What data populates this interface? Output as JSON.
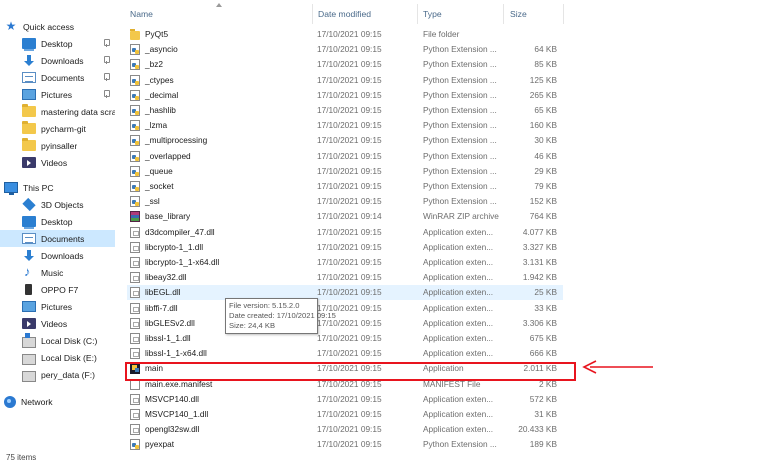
{
  "sidebar": {
    "items": [
      {
        "label": "Quick access",
        "icon": "star-icon",
        "pinned": false
      },
      {
        "label": "Desktop",
        "icon": "desktop-icon",
        "pinned": true
      },
      {
        "label": "Downloads",
        "icon": "downloads-icon",
        "pinned": true
      },
      {
        "label": "Documents",
        "icon": "documents-icon",
        "pinned": true
      },
      {
        "label": "Pictures",
        "icon": "pictures-icon",
        "pinned": true
      },
      {
        "label": "mastering data scra",
        "icon": "folder-icon",
        "pinned": false
      },
      {
        "label": "pycharm-git",
        "icon": "folder-icon",
        "pinned": false
      },
      {
        "label": "pyinsaller",
        "icon": "folder-icon",
        "pinned": false
      },
      {
        "label": "Videos",
        "icon": "videos-icon",
        "pinned": false
      },
      {
        "label": "This PC",
        "icon": "this-pc-icon",
        "pinned": false
      },
      {
        "label": "3D Objects",
        "icon": "3d-objects-icon",
        "pinned": false
      },
      {
        "label": "Desktop",
        "icon": "desktop-icon",
        "pinned": false
      },
      {
        "label": "Documents",
        "icon": "documents-icon",
        "pinned": false,
        "selected": true
      },
      {
        "label": "Downloads",
        "icon": "downloads-icon",
        "pinned": false
      },
      {
        "label": "Music",
        "icon": "music-icon",
        "pinned": false
      },
      {
        "label": "OPPO F7",
        "icon": "phone-icon",
        "pinned": false
      },
      {
        "label": "Pictures",
        "icon": "pictures-icon",
        "pinned": false
      },
      {
        "label": "Videos",
        "icon": "videos-icon",
        "pinned": false
      },
      {
        "label": "Local Disk (C:)",
        "icon": "drive-icon",
        "pinned": false
      },
      {
        "label": "Local Disk (E:)",
        "icon": "drive-icon",
        "pinned": false
      },
      {
        "label": "pery_data (F:)",
        "icon": "drive-icon",
        "pinned": false
      },
      {
        "label": "Network",
        "icon": "network-icon",
        "pinned": false
      }
    ]
  },
  "status": {
    "item_count": "75 items"
  },
  "columns": {
    "name": "Name",
    "date": "Date modified",
    "type": "Type",
    "size": "Size"
  },
  "files": [
    {
      "name": "PyQt5",
      "date": "17/10/2021 09:15",
      "type": "File folder",
      "size": "",
      "icon": "folder"
    },
    {
      "name": "_asyncio",
      "date": "17/10/2021 09:15",
      "type": "Python Extension ...",
      "size": "64 KB",
      "icon": "pyd"
    },
    {
      "name": "_bz2",
      "date": "17/10/2021 09:15",
      "type": "Python Extension ...",
      "size": "85 KB",
      "icon": "pyd"
    },
    {
      "name": "_ctypes",
      "date": "17/10/2021 09:15",
      "type": "Python Extension ...",
      "size": "125 KB",
      "icon": "pyd"
    },
    {
      "name": "_decimal",
      "date": "17/10/2021 09:15",
      "type": "Python Extension ...",
      "size": "265 KB",
      "icon": "pyd"
    },
    {
      "name": "_hashlib",
      "date": "17/10/2021 09:15",
      "type": "Python Extension ...",
      "size": "65 KB",
      "icon": "pyd"
    },
    {
      "name": "_lzma",
      "date": "17/10/2021 09:15",
      "type": "Python Extension ...",
      "size": "160 KB",
      "icon": "pyd"
    },
    {
      "name": "_multiprocessing",
      "date": "17/10/2021 09:15",
      "type": "Python Extension ...",
      "size": "30 KB",
      "icon": "pyd"
    },
    {
      "name": "_overlapped",
      "date": "17/10/2021 09:15",
      "type": "Python Extension ...",
      "size": "46 KB",
      "icon": "pyd"
    },
    {
      "name": "_queue",
      "date": "17/10/2021 09:15",
      "type": "Python Extension ...",
      "size": "29 KB",
      "icon": "pyd"
    },
    {
      "name": "_socket",
      "date": "17/10/2021 09:15",
      "type": "Python Extension ...",
      "size": "79 KB",
      "icon": "pyd"
    },
    {
      "name": "_ssl",
      "date": "17/10/2021 09:15",
      "type": "Python Extension ...",
      "size": "152 KB",
      "icon": "pyd"
    },
    {
      "name": "base_library",
      "date": "17/10/2021 09:14",
      "type": "WinRAR ZIP archive",
      "size": "764 KB",
      "icon": "rar"
    },
    {
      "name": "d3dcompiler_47.dll",
      "date": "17/10/2021 09:15",
      "type": "Application exten...",
      "size": "4.077 KB",
      "icon": "dll"
    },
    {
      "name": "libcrypto-1_1.dll",
      "date": "17/10/2021 09:15",
      "type": "Application exten...",
      "size": "3.327 KB",
      "icon": "dll"
    },
    {
      "name": "libcrypto-1_1-x64.dll",
      "date": "17/10/2021 09:15",
      "type": "Application exten...",
      "size": "3.131 KB",
      "icon": "dll"
    },
    {
      "name": "libeay32.dll",
      "date": "17/10/2021 09:15",
      "type": "Application exten...",
      "size": "1.942 KB",
      "icon": "dll"
    },
    {
      "name": "libEGL.dll",
      "date": "17/10/2021 09:15",
      "type": "Application exten...",
      "size": "25 KB",
      "icon": "dll",
      "hover": true
    },
    {
      "name": "libffi-7.dll",
      "date": "17/10/2021 09:15",
      "type": "Application exten...",
      "size": "33 KB",
      "icon": "dll"
    },
    {
      "name": "libGLESv2.dll",
      "date": "17/10/2021 09:15",
      "type": "Application exten...",
      "size": "3.306 KB",
      "icon": "dll"
    },
    {
      "name": "libssl-1_1.dll",
      "date": "17/10/2021 09:15",
      "type": "Application exten...",
      "size": "675 KB",
      "icon": "dll"
    },
    {
      "name": "libssl-1_1-x64.dll",
      "date": "17/10/2021 09:15",
      "type": "Application exten...",
      "size": "666 KB",
      "icon": "dll"
    },
    {
      "name": "main",
      "date": "17/10/2021 09:15",
      "type": "Application",
      "size": "2.011 KB",
      "icon": "exe",
      "highlighted": true
    },
    {
      "name": "main.exe.manifest",
      "date": "17/10/2021 09:15",
      "type": "MANIFEST File",
      "size": "2 KB",
      "icon": "manifest"
    },
    {
      "name": "MSVCP140.dll",
      "date": "17/10/2021 09:15",
      "type": "Application exten...",
      "size": "572 KB",
      "icon": "dll"
    },
    {
      "name": "MSVCP140_1.dll",
      "date": "17/10/2021 09:15",
      "type": "Application exten...",
      "size": "31 KB",
      "icon": "dll"
    },
    {
      "name": "opengl32sw.dll",
      "date": "17/10/2021 09:15",
      "type": "Application exten...",
      "size": "20.433 KB",
      "icon": "dll"
    },
    {
      "name": "pyexpat",
      "date": "17/10/2021 09:15",
      "type": "Python Extension ...",
      "size": "189 KB",
      "icon": "pyd"
    }
  ],
  "tooltip": {
    "file_version": "File version: 5.15.2.0",
    "date_created": "Date created: 17/10/2021 09:15",
    "size": "Size: 24,4 KB"
  },
  "annotation": {
    "color": "#e8141e"
  }
}
